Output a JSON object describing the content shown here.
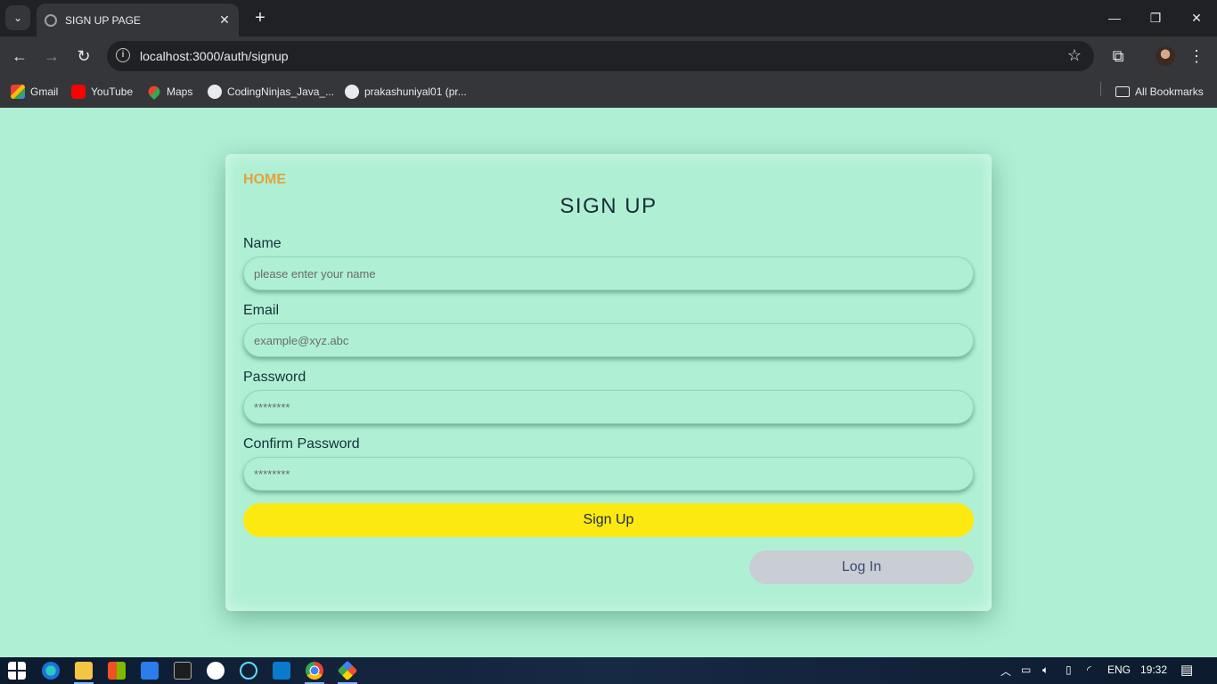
{
  "browser": {
    "tab_title": "SIGN UP PAGE",
    "url": "localhost:3000/auth/signup",
    "bookmarks": [
      {
        "label": "Gmail"
      },
      {
        "label": "YouTube"
      },
      {
        "label": "Maps"
      },
      {
        "label": "CodingNinjas_Java_..."
      },
      {
        "label": "prakashuniyal01 (pr..."
      }
    ],
    "all_bookmarks": "All Bookmarks"
  },
  "page": {
    "home_link": "HOME",
    "title": "SIGN UP",
    "fields": [
      {
        "label": "Name",
        "placeholder": "please enter your name"
      },
      {
        "label": "Email",
        "placeholder": "example@xyz.abc"
      },
      {
        "label": "Password",
        "placeholder": "********"
      },
      {
        "label": "Confirm Password",
        "placeholder": "********"
      }
    ],
    "signup_button": "Sign Up",
    "login_button": "Log In",
    "colors": {
      "background": "#aff0d4",
      "signup": "#fde912",
      "login": "#c8ced3",
      "home": "#e2a23e"
    }
  },
  "taskbar": {
    "language": "ENG",
    "time": "19:32"
  }
}
